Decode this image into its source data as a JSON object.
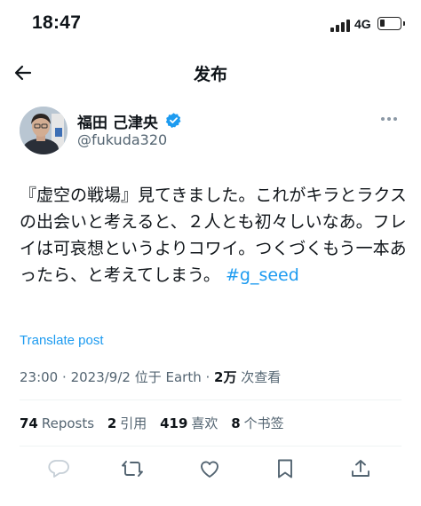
{
  "status_bar": {
    "time": "18:47",
    "network": "4G"
  },
  "nav": {
    "title": "发布"
  },
  "author": {
    "name": "福田 己津央",
    "handle": "@fukuda320"
  },
  "tweet": {
    "text": "『虚空の戦場』見てきました。これがキラとラクスの出会いと考えると、２人とも初々しいなあ。フレイは可哀想というよりコワイ。つくづくもう一本あったら、と考えてしまう。",
    "hashtag": "#g_seed"
  },
  "translate_label": "Translate post",
  "meta": {
    "time": "23:00",
    "date": "2023/9/2",
    "location": "位于 Earth",
    "views_count": "2万",
    "views_label": "次查看"
  },
  "stats": {
    "reposts_count": "74",
    "reposts_label": "Reposts",
    "quotes_count": "2",
    "quotes_label": "引用",
    "likes_count": "419",
    "likes_label": "喜欢",
    "bookmarks_count": "8",
    "bookmarks_label": "个书签"
  },
  "colors": {
    "accent": "#1d9bf0",
    "secondary_text": "#536471",
    "primary_text": "#0f1419"
  },
  "icons": [
    "back-arrow-icon",
    "verified-icon",
    "more-icon",
    "reply-icon",
    "repost-icon",
    "like-icon",
    "bookmark-icon",
    "share-icon"
  ]
}
